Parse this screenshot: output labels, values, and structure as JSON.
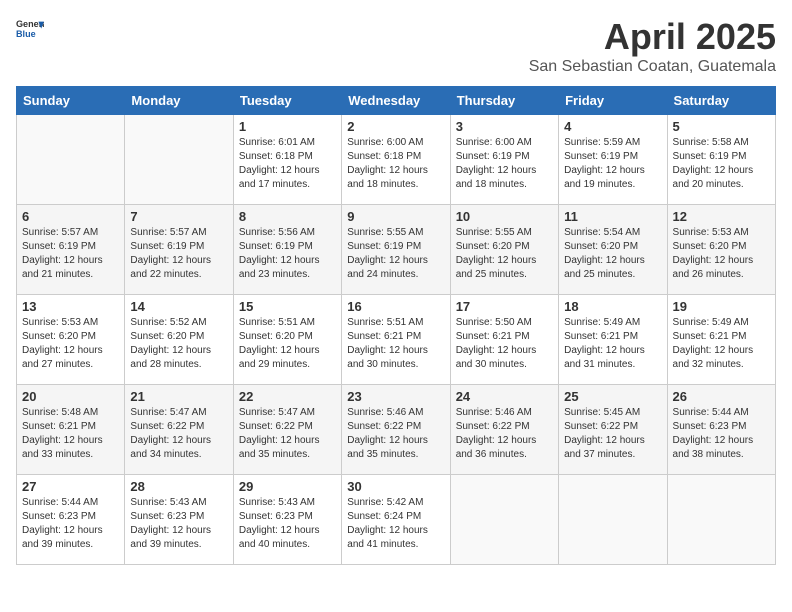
{
  "header": {
    "logo_general": "General",
    "logo_blue": "Blue",
    "month_title": "April 2025",
    "subtitle": "San Sebastian Coatan, Guatemala"
  },
  "days_of_week": [
    "Sunday",
    "Monday",
    "Tuesday",
    "Wednesday",
    "Thursday",
    "Friday",
    "Saturday"
  ],
  "weeks": [
    [
      null,
      null,
      {
        "day": 1,
        "sunrise": "6:01 AM",
        "sunset": "6:18 PM",
        "daylight": "12 hours and 17 minutes."
      },
      {
        "day": 2,
        "sunrise": "6:00 AM",
        "sunset": "6:18 PM",
        "daylight": "12 hours and 18 minutes."
      },
      {
        "day": 3,
        "sunrise": "6:00 AM",
        "sunset": "6:19 PM",
        "daylight": "12 hours and 18 minutes."
      },
      {
        "day": 4,
        "sunrise": "5:59 AM",
        "sunset": "6:19 PM",
        "daylight": "12 hours and 19 minutes."
      },
      {
        "day": 5,
        "sunrise": "5:58 AM",
        "sunset": "6:19 PM",
        "daylight": "12 hours and 20 minutes."
      }
    ],
    [
      {
        "day": 6,
        "sunrise": "5:57 AM",
        "sunset": "6:19 PM",
        "daylight": "12 hours and 21 minutes."
      },
      {
        "day": 7,
        "sunrise": "5:57 AM",
        "sunset": "6:19 PM",
        "daylight": "12 hours and 22 minutes."
      },
      {
        "day": 8,
        "sunrise": "5:56 AM",
        "sunset": "6:19 PM",
        "daylight": "12 hours and 23 minutes."
      },
      {
        "day": 9,
        "sunrise": "5:55 AM",
        "sunset": "6:19 PM",
        "daylight": "12 hours and 24 minutes."
      },
      {
        "day": 10,
        "sunrise": "5:55 AM",
        "sunset": "6:20 PM",
        "daylight": "12 hours and 25 minutes."
      },
      {
        "day": 11,
        "sunrise": "5:54 AM",
        "sunset": "6:20 PM",
        "daylight": "12 hours and 25 minutes."
      },
      {
        "day": 12,
        "sunrise": "5:53 AM",
        "sunset": "6:20 PM",
        "daylight": "12 hours and 26 minutes."
      }
    ],
    [
      {
        "day": 13,
        "sunrise": "5:53 AM",
        "sunset": "6:20 PM",
        "daylight": "12 hours and 27 minutes."
      },
      {
        "day": 14,
        "sunrise": "5:52 AM",
        "sunset": "6:20 PM",
        "daylight": "12 hours and 28 minutes."
      },
      {
        "day": 15,
        "sunrise": "5:51 AM",
        "sunset": "6:20 PM",
        "daylight": "12 hours and 29 minutes."
      },
      {
        "day": 16,
        "sunrise": "5:51 AM",
        "sunset": "6:21 PM",
        "daylight": "12 hours and 30 minutes."
      },
      {
        "day": 17,
        "sunrise": "5:50 AM",
        "sunset": "6:21 PM",
        "daylight": "12 hours and 30 minutes."
      },
      {
        "day": 18,
        "sunrise": "5:49 AM",
        "sunset": "6:21 PM",
        "daylight": "12 hours and 31 minutes."
      },
      {
        "day": 19,
        "sunrise": "5:49 AM",
        "sunset": "6:21 PM",
        "daylight": "12 hours and 32 minutes."
      }
    ],
    [
      {
        "day": 20,
        "sunrise": "5:48 AM",
        "sunset": "6:21 PM",
        "daylight": "12 hours and 33 minutes."
      },
      {
        "day": 21,
        "sunrise": "5:47 AM",
        "sunset": "6:22 PM",
        "daylight": "12 hours and 34 minutes."
      },
      {
        "day": 22,
        "sunrise": "5:47 AM",
        "sunset": "6:22 PM",
        "daylight": "12 hours and 35 minutes."
      },
      {
        "day": 23,
        "sunrise": "5:46 AM",
        "sunset": "6:22 PM",
        "daylight": "12 hours and 35 minutes."
      },
      {
        "day": 24,
        "sunrise": "5:46 AM",
        "sunset": "6:22 PM",
        "daylight": "12 hours and 36 minutes."
      },
      {
        "day": 25,
        "sunrise": "5:45 AM",
        "sunset": "6:22 PM",
        "daylight": "12 hours and 37 minutes."
      },
      {
        "day": 26,
        "sunrise": "5:44 AM",
        "sunset": "6:23 PM",
        "daylight": "12 hours and 38 minutes."
      }
    ],
    [
      {
        "day": 27,
        "sunrise": "5:44 AM",
        "sunset": "6:23 PM",
        "daylight": "12 hours and 39 minutes."
      },
      {
        "day": 28,
        "sunrise": "5:43 AM",
        "sunset": "6:23 PM",
        "daylight": "12 hours and 39 minutes."
      },
      {
        "day": 29,
        "sunrise": "5:43 AM",
        "sunset": "6:23 PM",
        "daylight": "12 hours and 40 minutes."
      },
      {
        "day": 30,
        "sunrise": "5:42 AM",
        "sunset": "6:24 PM",
        "daylight": "12 hours and 41 minutes."
      },
      null,
      null,
      null
    ]
  ]
}
